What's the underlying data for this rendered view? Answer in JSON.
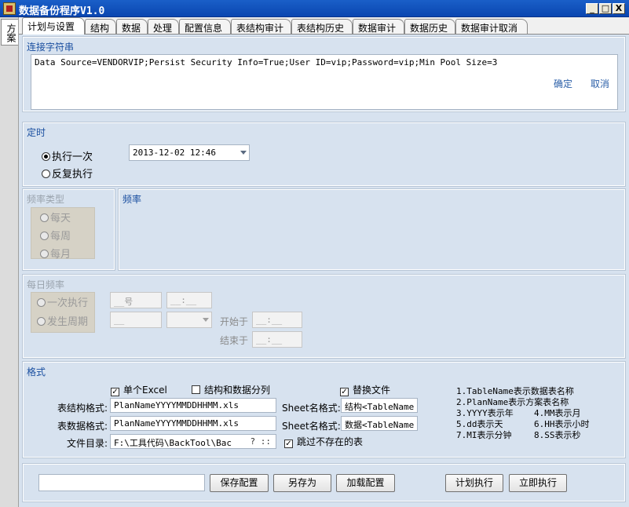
{
  "window": {
    "title": "数据备份程序V1.0",
    "min": "_",
    "max": "□",
    "close": "X"
  },
  "side_tab": {
    "label": "方案"
  },
  "tabs": [
    "计划与设置",
    "结构",
    "数据",
    "处理",
    "配置信息",
    "表结构审计",
    "表结构历史",
    "数据审计",
    "数据历史",
    "数据审计取消"
  ],
  "connection": {
    "legend": "连接字符串",
    "value": "Data Source=VENDORVIP;Persist Security Info=True;User ID=vip;Password=vip;Min Pool Size=3",
    "confirm": "确定",
    "cancel": "取消"
  },
  "timer": {
    "legend": "定时",
    "once": "执行一次",
    "repeat": "反复执行",
    "datetime": "2013-12-02 12:46"
  },
  "freq_type": {
    "legend": "频率类型",
    "daily": "每天",
    "weekly": "每周",
    "monthly": "每月"
  },
  "freq": {
    "legend": "频率"
  },
  "daily_freq": {
    "legend": "每日频率",
    "once": "一次执行",
    "periodic": "发生周期",
    "day_field": "__号",
    "time_field": "__:__",
    "interval_field": "__",
    "start_label": "开始于",
    "start_field": "__:__",
    "end_label": "结束于",
    "end_field": "__:__"
  },
  "format": {
    "legend": "格式",
    "single_excel": "单个Excel",
    "split": "结构和数据分列",
    "replace": "替换文件",
    "skip": "跳过不存在的表",
    "struct_label": "表结构格式:",
    "struct_value": "PlanNameYYYYMMDDHHMM.xls",
    "data_label": "表数据格式:",
    "data_value": "PlanNameYYYYMMDDHHMM.xls",
    "dir_label": "文件目录:",
    "dir_value": "F:\\工具代码\\BackTool\\Bac",
    "dir_btn": "? ::",
    "sheet1_label": "Sheet名格式:",
    "sheet1_value": "结构<TableName",
    "sheet2_label": "Sheet名格式:",
    "sheet2_value": "数据<TableName",
    "hints": [
      "1.TableName表示数据表名称",
      "2.PlanName表示方案表名称",
      "3.YYYY表示年",
      "4.MM表示月",
      "5.dd表示天",
      "6.HH表示小时",
      "7.MI表示分钟",
      "8.SS表示秒"
    ]
  },
  "bottom": {
    "name_value": "",
    "save_config": "保存配置",
    "save_as": "另存为",
    "load_config": "加载配置",
    "plan_run": "计划执行",
    "run_now": "立即执行"
  }
}
